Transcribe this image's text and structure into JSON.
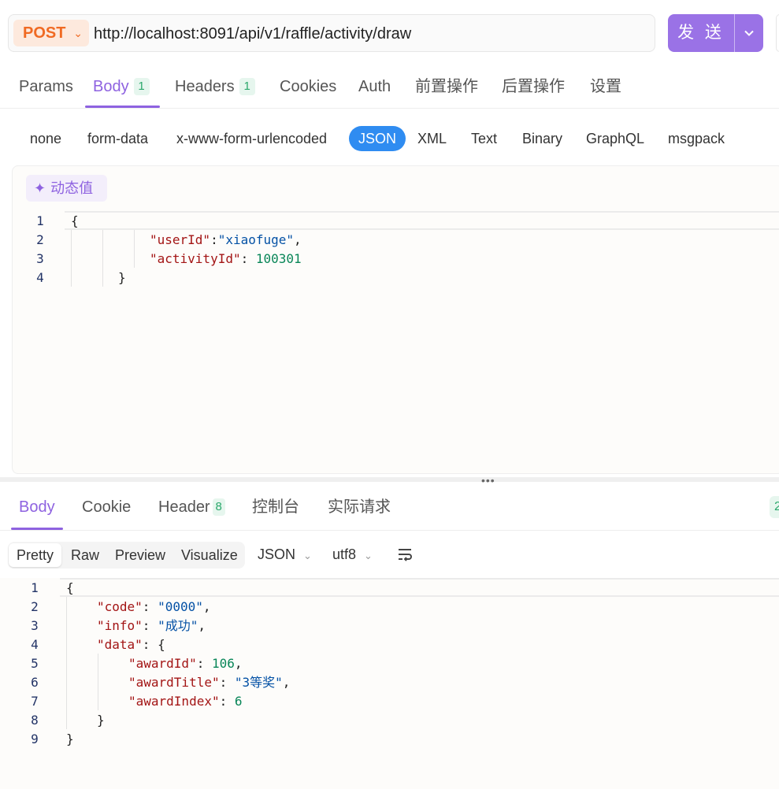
{
  "request": {
    "method": "POST",
    "url": "http://localhost:8091/api/v1/raffle/activity/draw",
    "send_label": "发 送"
  },
  "request_tabs": [
    {
      "label": "Params",
      "badge": ""
    },
    {
      "label": "Body",
      "badge": "1",
      "active": true
    },
    {
      "label": "Headers",
      "badge": "1"
    },
    {
      "label": "Cookies",
      "badge": ""
    },
    {
      "label": "Auth",
      "badge": ""
    },
    {
      "label": "前置操作",
      "badge": ""
    },
    {
      "label": "后置操作",
      "badge": ""
    },
    {
      "label": "设置",
      "badge": ""
    }
  ],
  "body_types": [
    "none",
    "form-data",
    "x-www-form-urlencoded",
    "JSON",
    "XML",
    "Text",
    "Binary",
    "GraphQL",
    "msgpack"
  ],
  "body_type_selected": "JSON",
  "dynamic_value_label": "动态值",
  "request_body": {
    "line_numbers": [
      "1",
      "2",
      "3",
      "4"
    ],
    "userId_key": "\"userId\"",
    "userId_value": "\"xiaofuge\"",
    "activityId_key": "\"activityId\"",
    "activityId_value": "100301"
  },
  "response_tabs": [
    {
      "label": "Body",
      "badge": "",
      "active": true
    },
    {
      "label": "Cookie",
      "badge": ""
    },
    {
      "label": "Header",
      "badge": "8"
    },
    {
      "label": "控制台",
      "badge": ""
    },
    {
      "label": "实际请求",
      "badge": ""
    }
  ],
  "status_peek": "2",
  "response_view": {
    "modes": [
      "Pretty",
      "Raw",
      "Preview",
      "Visualize"
    ],
    "selected": "Pretty",
    "format": "JSON",
    "encoding": "utf8"
  },
  "response_body": {
    "line_numbers": [
      "1",
      "2",
      "3",
      "4",
      "5",
      "6",
      "7",
      "8",
      "9"
    ],
    "code_key": "\"code\"",
    "code_value": "\"0000\"",
    "info_key": "\"info\"",
    "info_value": "\"成功\"",
    "data_key": "\"data\"",
    "awardId_key": "\"awardId\"",
    "awardId_value": "106",
    "awardTitle_key": "\"awardTitle\"",
    "awardTitle_value": "\"3等奖\"",
    "awardIndex_key": "\"awardIndex\"",
    "awardIndex_value": "6"
  },
  "colors": {
    "accent": "#8e62e0",
    "method": "#f06a23",
    "json_selected": "#2f8cf1",
    "badge_green": "#2ba86c"
  }
}
